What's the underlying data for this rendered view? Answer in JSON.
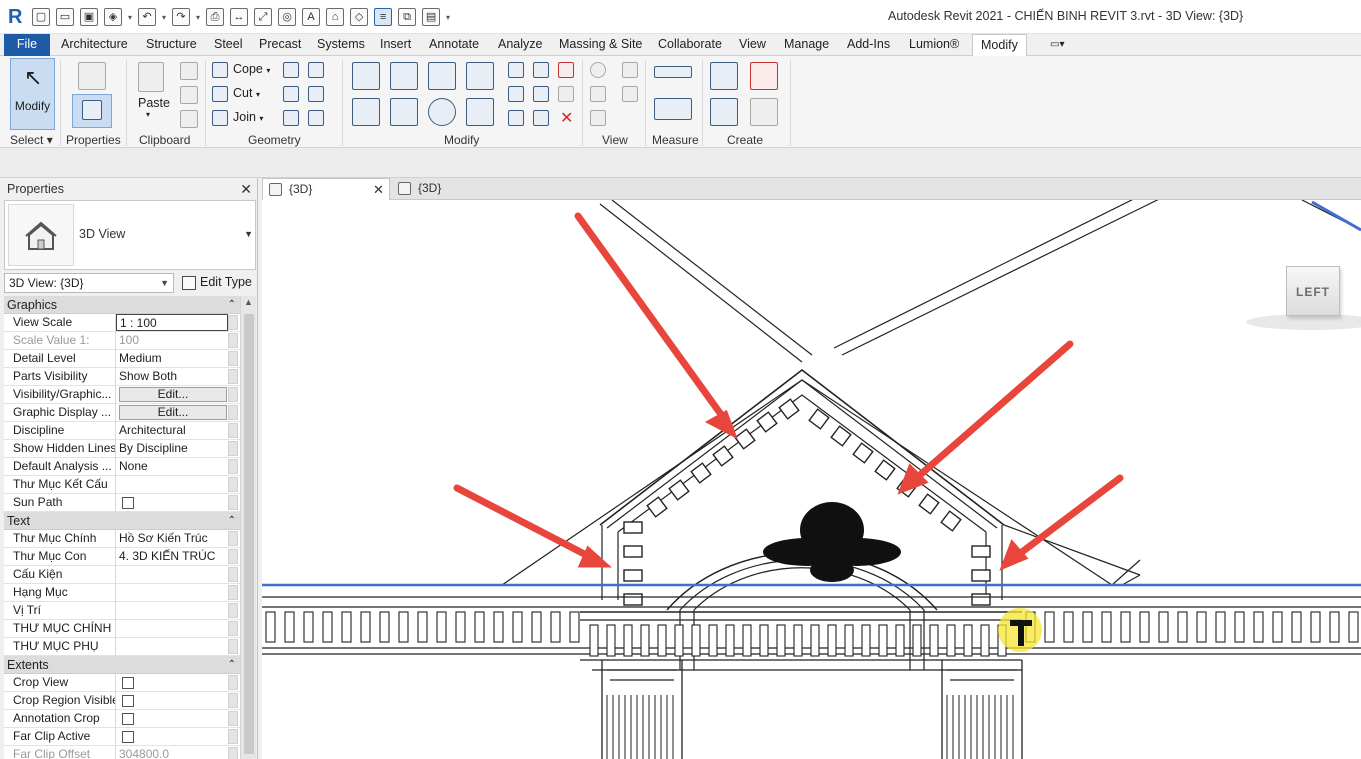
{
  "app": {
    "logo": "R",
    "title": "Autodesk Revit 2021 - CHIẾN BINH REVIT 3.rvt - 3D View: {3D}"
  },
  "menu": {
    "file": "File",
    "tabs": [
      "Architecture",
      "Structure",
      "Steel",
      "Precast",
      "Systems",
      "Insert",
      "Annotate",
      "Analyze",
      "Massing & Site",
      "Collaborate",
      "View",
      "Manage",
      "Add-Ins",
      "Lumion®",
      "Modify"
    ],
    "active": "Modify"
  },
  "ribbon": {
    "select_group": "Select",
    "modify_label": "Modify",
    "properties_group": "Properties",
    "paste_label": "Paste",
    "clipboard_group": "Clipboard",
    "cope_label": "Cope",
    "cut_label": "Cut",
    "join_label": "Join",
    "geometry_group": "Geometry",
    "modify_group": "Modify",
    "view_group": "View",
    "measure_group": "Measure",
    "create_group": "Create"
  },
  "properties": {
    "title": "Properties",
    "type_name": "3D View",
    "selector": "3D View: {3D}",
    "edit_type": "Edit Type",
    "groups": [
      {
        "name": "Graphics",
        "rows": [
          {
            "k": "View Scale",
            "v": "1 : 100",
            "style": "boxed"
          },
          {
            "k": "Scale Value    1:",
            "v": "100",
            "style": "disabled"
          },
          {
            "k": "Detail Level",
            "v": "Medium"
          },
          {
            "k": "Parts Visibility",
            "v": "Show Both"
          },
          {
            "k": "Visibility/Graphic...",
            "v": "Edit...",
            "style": "button"
          },
          {
            "k": "Graphic Display ...",
            "v": "Edit...",
            "style": "button"
          },
          {
            "k": "Discipline",
            "v": "Architectural"
          },
          {
            "k": "Show Hidden Lines",
            "v": "By Discipline"
          },
          {
            "k": "Default Analysis ...",
            "v": "None"
          },
          {
            "k": "Thư Mục Kết Cấu",
            "v": ""
          },
          {
            "k": "Sun Path",
            "v": "",
            "style": "checkbox"
          }
        ]
      },
      {
        "name": "Text",
        "rows": [
          {
            "k": "Thư Mục Chính",
            "v": "Hồ Sơ Kiến Trúc"
          },
          {
            "k": "Thư Mục Con",
            "v": "4. 3D KIẾN TRÚC"
          },
          {
            "k": "Cấu Kiện",
            "v": ""
          },
          {
            "k": "Hạng Mục",
            "v": ""
          },
          {
            "k": "Vị Trí",
            "v": ""
          },
          {
            "k": "THƯ MỤC CHÍNH",
            "v": ""
          },
          {
            "k": "THƯ MỤC PHỤ",
            "v": ""
          }
        ]
      },
      {
        "name": "Extents",
        "rows": [
          {
            "k": "Crop View",
            "v": "",
            "style": "checkbox"
          },
          {
            "k": "Crop Region Visible",
            "v": "",
            "style": "checkbox"
          },
          {
            "k": "Annotation Crop",
            "v": "",
            "style": "checkbox"
          },
          {
            "k": "Far Clip Active",
            "v": "",
            "style": "checkbox"
          },
          {
            "k": "Far Clip Offset",
            "v": "304800.0",
            "style": "disabled"
          }
        ]
      }
    ]
  },
  "view_tabs": [
    {
      "label": "{3D}",
      "active": true
    },
    {
      "label": "{3D}",
      "active": false
    }
  ],
  "viewcube_face": "LEFT",
  "colors": {
    "accent": "#1f5aa6",
    "annotation_arrow": "#e8453c",
    "cursor_highlight": "#f5e631",
    "level_line": "#3f6fd1"
  }
}
